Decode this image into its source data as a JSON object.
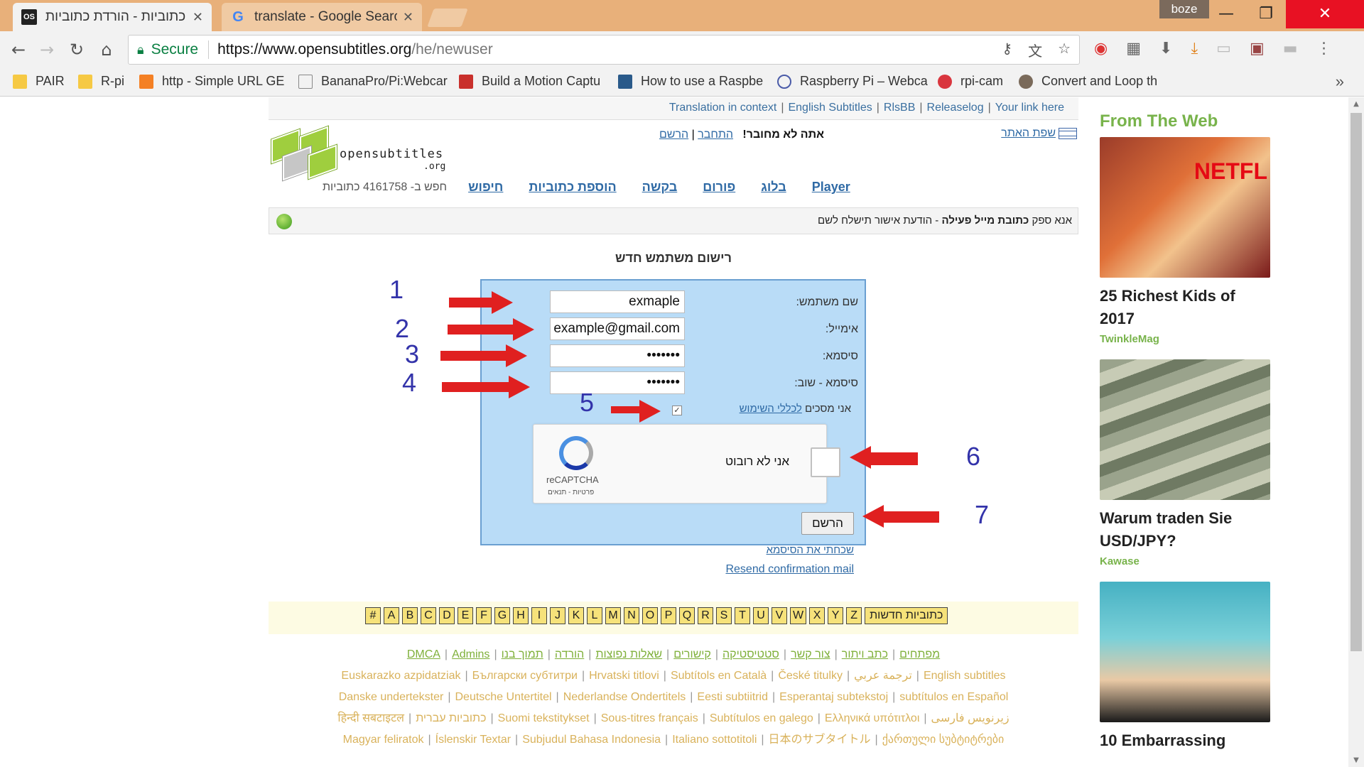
{
  "browser": {
    "tabs": [
      {
        "title": "כתוביות - הורדת כתוביות",
        "favicon": "OS",
        "active": true
      },
      {
        "title": "translate - Google Search",
        "favicon": "G",
        "active": false
      }
    ],
    "user_badge": "boze",
    "omnibox": {
      "secure_label": "Secure",
      "url_host": "https://www.opensubtitles.org",
      "url_path": "/he/newuser"
    },
    "bookmarks": [
      {
        "label": "PAIR",
        "icon": "folder-icon"
      },
      {
        "label": "R-pi",
        "icon": "folder-icon"
      },
      {
        "label": "http - Simple URL GE",
        "icon": "stack-icon"
      },
      {
        "label": "BananaPro/Pi:Webcar",
        "icon": "page-icon"
      },
      {
        "label": "Build a Motion Captu",
        "icon": "motion-icon"
      },
      {
        "label": "How to use a Raspbe",
        "icon": "tr-icon"
      },
      {
        "label": "Raspberry Pi – Webca",
        "icon": "raspberry-icon"
      },
      {
        "label": "rpi-cam",
        "icon": "rpi-icon"
      },
      {
        "label": "Convert and Loop th",
        "icon": "avatar-icon"
      }
    ],
    "bookmarks_more": "»"
  },
  "site": {
    "top_links": [
      "Translation in context",
      "English Subtitles",
      "RlsBB",
      "Releaselog",
      "Your link here"
    ],
    "logo_text": "opensubtitles",
    "logo_suffix": ".org",
    "login": {
      "status": "אתה לא מחובר!",
      "login_link": "התחבר",
      "register_link": "הרשם"
    },
    "site_language": "שפת האתר",
    "nav": {
      "count": "חפש ב- 4161758 כתוביות",
      "items": [
        "חיפוש",
        "הוספת כתוביות",
        "בקשה",
        "פורום",
        "בלוג",
        "Player"
      ]
    },
    "info_bold": "כתובת מייל פעילה",
    "info_prefix": "אנא ספק",
    "info_suffix": "- הודעת אישור תישלח לשם",
    "register": {
      "title": "רישום משתמש חדש",
      "username_label": "שם משתמש:",
      "username_value": "exmaple",
      "email_label": "אימייל:",
      "email_value": "example@gmail.com",
      "password_label": "סיסמא:",
      "password_value": "•••••••",
      "password2_label": "סיסמא - שוב:",
      "password2_value": "•••••••",
      "agree_text": "אני מסכים",
      "terms_link": "לכללי השימוש",
      "captcha_text": "אני לא רובוט",
      "captcha_brand": "reCAPTCHA",
      "captcha_small": "פרטיות - תנאים",
      "submit_label": "הרשם",
      "forgot_link": "שכחתי את הסיסמא",
      "resend_link": "Resend confirmation mail"
    },
    "annotations": [
      "1",
      "2",
      "3",
      "4",
      "5",
      "6",
      "7"
    ],
    "alphabet": [
      "#",
      "A",
      "B",
      "C",
      "D",
      "E",
      "F",
      "G",
      "H",
      "I",
      "J",
      "K",
      "L",
      "M",
      "N",
      "O",
      "P",
      "Q",
      "R",
      "S",
      "T",
      "U",
      "V",
      "W",
      "X",
      "Y",
      "Z"
    ],
    "new_subtitles": "כתוביות חדשות",
    "footer_links": [
      "DMCA",
      "Admins",
      "מפתחים",
      "כתב ויתור",
      "צור קשר",
      "סטטיסטיקה",
      "קישורים",
      "שאלות נפוצות",
      "הורדה",
      "תמוך בנו"
    ],
    "footer_langs_1": [
      "Euskarazko azpidatziak",
      "Български субтитри",
      "Hrvatski titlovi",
      "Subtítols en Català",
      "České titulky",
      "ترجمة عربي",
      "English subtitles"
    ],
    "footer_langs_2": [
      "Danske undertekster",
      "Deutsche Untertitel",
      "Nederlandse Ondertitels",
      "Eesti subtiitrid",
      "Esperantaj subtekstoj",
      "subtítulos en Español"
    ],
    "footer_langs_3": [
      "हिन्दी सबटाइटल",
      "כתוביות עברית",
      "Suomi tekstitykset",
      "Sous-titres français",
      "Subtítulos en galego",
      "Ελληνικά υπότιτλοι",
      "زیرنویس فارسی"
    ],
    "footer_langs_4": [
      "Magyar feliratok",
      "Íslenskir Textar",
      "Subjudul Bahasa Indonesia",
      "Italiano sottotitoli",
      "日本のサブタイトル",
      "ქართული სუბტიტრები"
    ]
  },
  "ads": {
    "header": "From The Web",
    "items": [
      {
        "title": "25 Richest Kids of 2017",
        "source": "TwinkleMag",
        "badge": "NETFL"
      },
      {
        "title": "Warum traden Sie USD/JPY?",
        "source": "Kawase"
      },
      {
        "title": "10 Embarrassing",
        "source": ""
      }
    ]
  }
}
